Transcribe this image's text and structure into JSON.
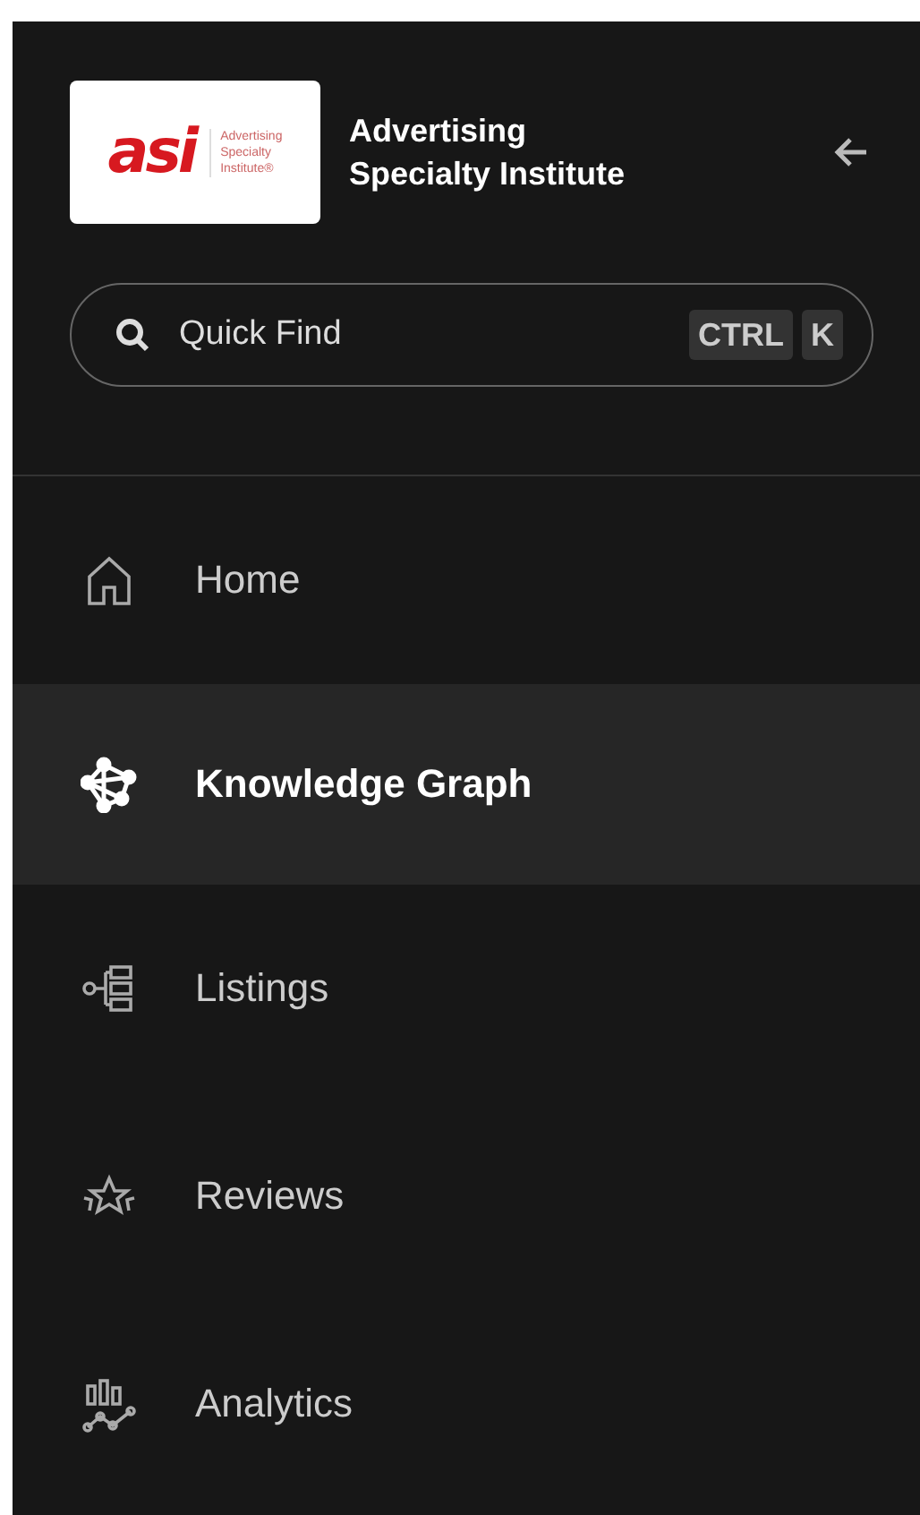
{
  "brand": {
    "logo_mark": "asi",
    "logo_tagline": [
      "Advertising",
      "Specialty",
      "Institute®"
    ],
    "name": "Advertising Specialty Institute"
  },
  "search": {
    "placeholder": "Quick Find",
    "shortcut": [
      "CTRL",
      "K"
    ]
  },
  "nav": [
    {
      "label": "Home",
      "kind": "home",
      "selected": false
    },
    {
      "label": "Knowledge Graph",
      "kind": "graph",
      "selected": true
    },
    {
      "label": "Listings",
      "kind": "listings",
      "selected": false
    },
    {
      "label": "Reviews",
      "kind": "reviews",
      "selected": false
    },
    {
      "label": "Analytics",
      "kind": "analytics",
      "selected": false
    }
  ]
}
